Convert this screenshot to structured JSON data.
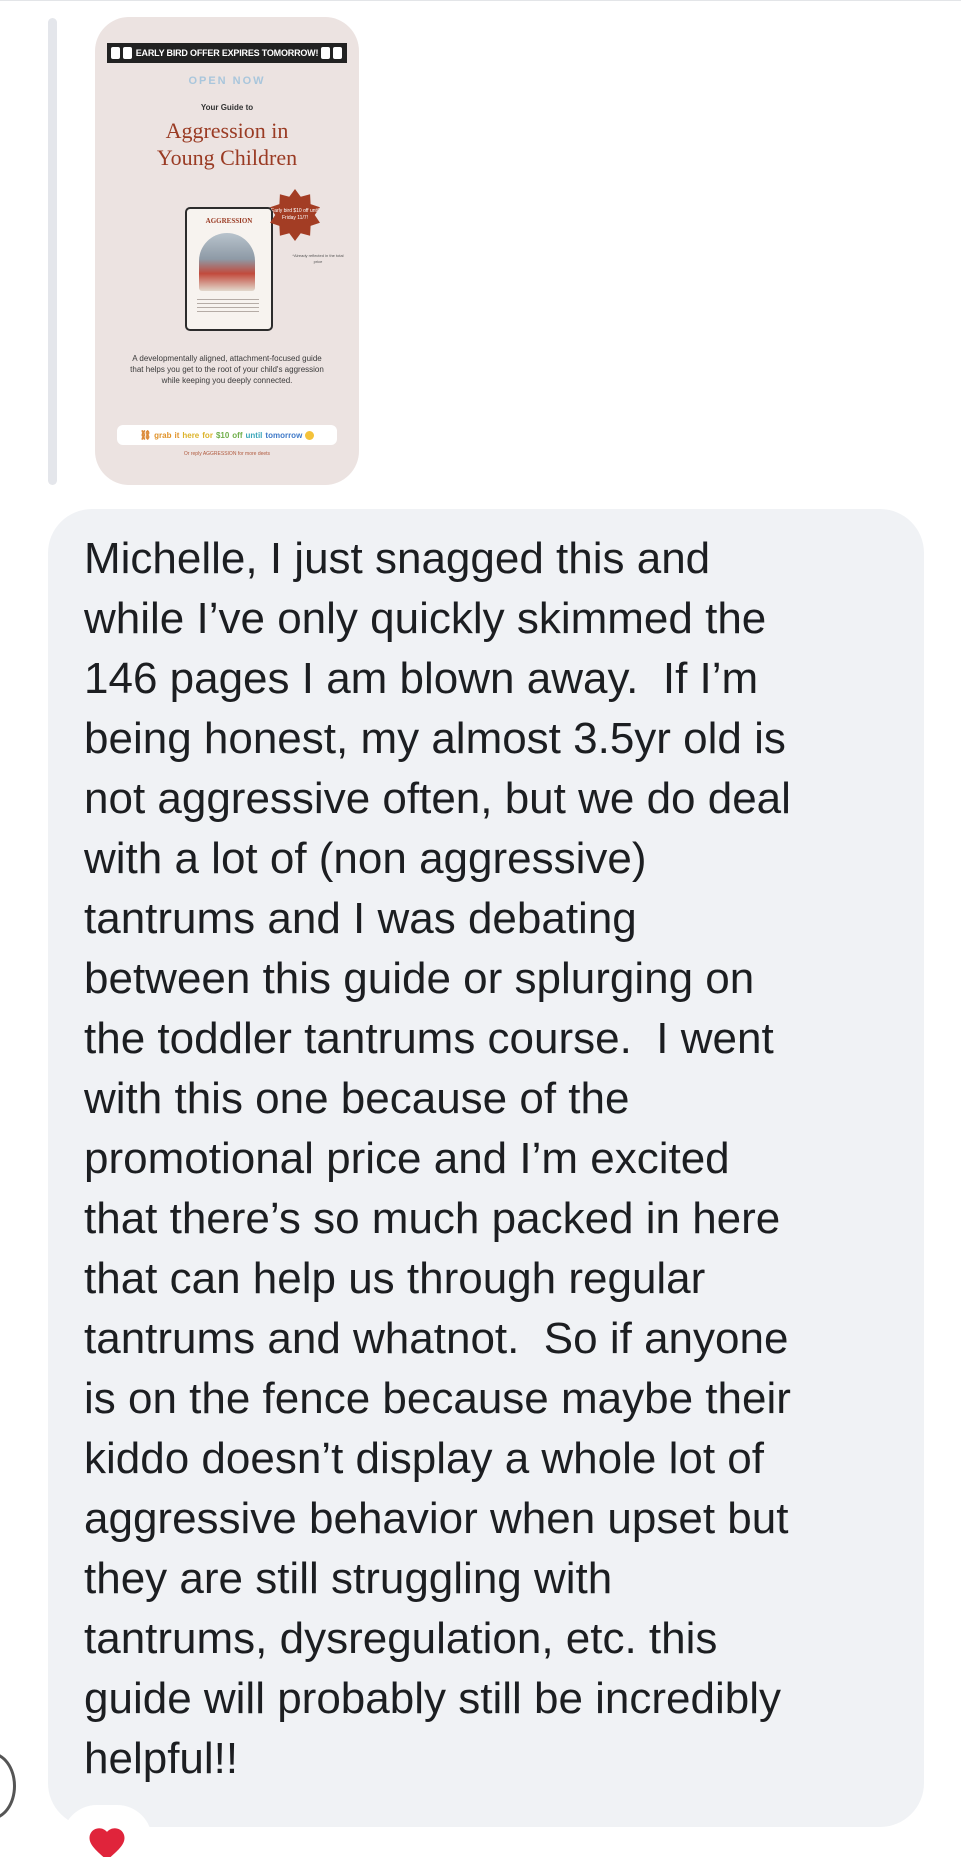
{
  "story": {
    "banner": "EARLY BIRD OFFER EXPIRES TOMORROW!",
    "open_now": "OPEN NOW",
    "subtitle": "Your Guide to",
    "title_line1": "Aggression in",
    "title_line2": "Young Children",
    "book_title": "AGGRESSION",
    "badge_text": "Early bird $10 off until Friday 11/7!",
    "tiny_note": "*Already reflected in the total price",
    "description": "A developmentally aligned, attachment-focused guide that helps you get to the root of your child's aggression while keeping you deeply connected.",
    "cta": {
      "w1": "grab",
      "w2": "it",
      "w3": "here",
      "w4": "for",
      "w5": "$10",
      "w6": "off",
      "w7": "until",
      "w8": "tomorrow"
    },
    "reply_note": "Or reply AGGRESSION for more deets"
  },
  "message": {
    "text": "Michelle, I just snagged this and\nwhile I’ve only quickly skimmed the\n146 pages I am blown away.  If I’m\nbeing honest, my almost 3.5yr old is\nnot aggressive often, but we do deal\nwith a lot of (non aggressive)\ntantrums and I was debating\nbetween this guide or splurging on\nthe toddler tantrums course.  I went\nwith this one because of the\npromotional price and I’m excited\nthat there’s so much packed in here\nthat can help us through regular\ntantrums and whatnot.  So if anyone\nis on the fence because maybe their\nkiddo doesn’t display a whole lot of\naggressive behavior when upset but\nthey are still struggling with\ntantrums, dysregulation, etc. this\nguide will probably still be incredibly\nhelpful!!"
  },
  "reaction": {
    "icon": "heart-icon",
    "color": "#e0243b"
  },
  "colors": {
    "bubble": "#f0f2f5",
    "text": "#1c1e21",
    "story_bg": "#ece3e1",
    "title_red": "#9a3b24"
  }
}
